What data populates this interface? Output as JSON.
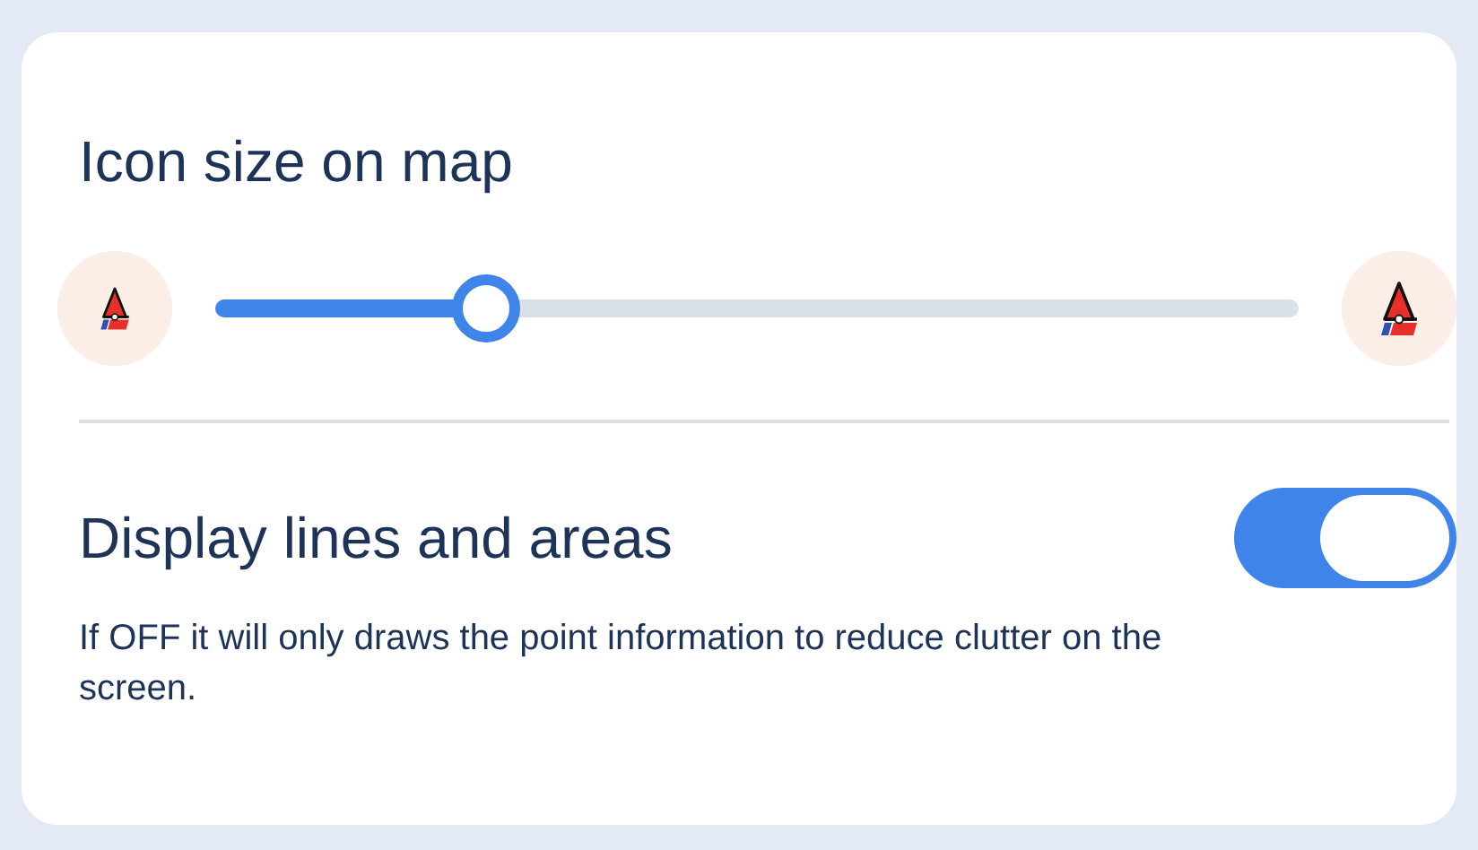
{
  "icon_size": {
    "title": "Icon size on map",
    "level": 0.25
  },
  "display_lines": {
    "title": "Display lines and areas",
    "on": true,
    "description": "If OFF it will only draws the point information to reduce clutter on the screen."
  }
}
